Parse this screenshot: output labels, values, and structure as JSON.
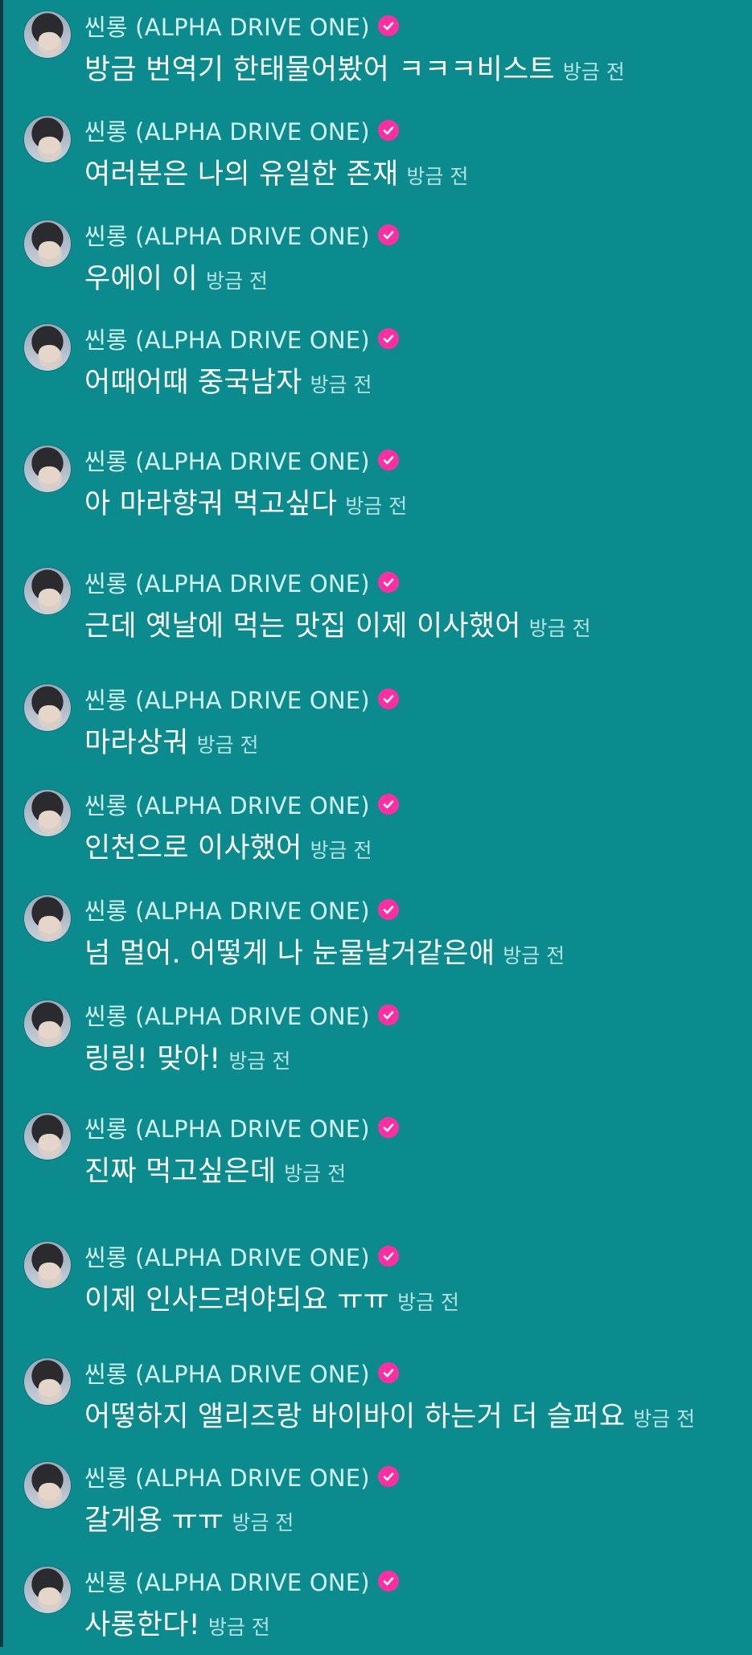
{
  "messages": [
    {
      "name": "씬롱 (ALPHA DRIVE ONE)",
      "text": "방금 번역기 한태물어봤어 ㅋㅋㅋ비스트",
      "time": "방금 전"
    },
    {
      "name": "씬롱 (ALPHA DRIVE ONE)",
      "text": "여러분은 나의 유일한 존재",
      "time": "방금 전"
    },
    {
      "name": "씬롱 (ALPHA DRIVE ONE)",
      "text": "우에이 이",
      "time": "방금 전"
    },
    {
      "name": "씬롱 (ALPHA DRIVE ONE)",
      "text": "어때어때 중국남자",
      "time": "방금 전"
    },
    {
      "name": "씬롱 (ALPHA DRIVE ONE)",
      "text": "아 마라향궈 먹고싶다",
      "time": "방금 전"
    },
    {
      "name": "씬롱 (ALPHA DRIVE ONE)",
      "text": "근데 옛날에 먹는 맛집 이제 이사했어",
      "time": "방금 전"
    },
    {
      "name": "씬롱 (ALPHA DRIVE ONE)",
      "text": "마라상궈",
      "time": "방금 전"
    },
    {
      "name": "씬롱 (ALPHA DRIVE ONE)",
      "text": "인천으로 이사했어",
      "time": "방금 전"
    },
    {
      "name": "씬롱 (ALPHA DRIVE ONE)",
      "text": "넘 멀어.  어떻게 나 눈물날거같은애",
      "time": "방금 전"
    },
    {
      "name": "씬롱 (ALPHA DRIVE ONE)",
      "text": "링링! 맞아!",
      "time": "방금 전"
    },
    {
      "name": "씬롱 (ALPHA DRIVE ONE)",
      "text": "진짜 먹고싶은데",
      "time": "방금 전"
    },
    {
      "name": "씬롱 (ALPHA DRIVE ONE)",
      "text": "이제 인사드려야되요 ㅠㅠ",
      "time": "방금 전"
    },
    {
      "name": "씬롱 (ALPHA DRIVE ONE)",
      "text": "어떻하지 앨리즈랑 바이바이 하는거 더 슬퍼요",
      "time": "방금 전"
    },
    {
      "name": "씬롱 (ALPHA DRIVE ONE)",
      "text": "갈게용 ㅠㅠ",
      "time": "방금 전"
    },
    {
      "name": "씬롱 (ALPHA DRIVE ONE)",
      "text": "사롱한다!",
      "time": "방금 전"
    }
  ],
  "icons": {
    "verified": "verified-check-icon"
  },
  "colors": {
    "background": "#0b8b8e",
    "verified_badge": "#ff2ea3",
    "name_text": "#d3f2f2",
    "message_text": "#ffffff",
    "time_text": "#b6e1e2"
  }
}
